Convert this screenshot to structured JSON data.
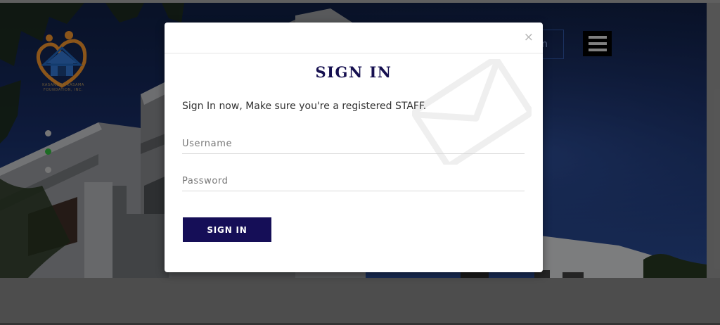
{
  "header": {
    "partial_button_label": "n",
    "menu_icon": "hamburger-icon"
  },
  "logo": {
    "icon": "house-family-logo",
    "text": "KASANGGA KASAMA FOUNDATION, INC."
  },
  "carousel": {
    "dots": 3,
    "active_index": 1,
    "active_color": "#2fae3b"
  },
  "modal": {
    "title": "SIGN IN",
    "close_label": "×",
    "description": "Sign In now, Make sure you're a registered STAFF.",
    "username_placeholder": "Username",
    "username_value": "",
    "password_placeholder": "Password",
    "password_value": "",
    "submit_label": "SIGN IN",
    "watermark_icon": "envelope-icon"
  },
  "colors": {
    "primary": "#150e57",
    "title": "#161050"
  }
}
